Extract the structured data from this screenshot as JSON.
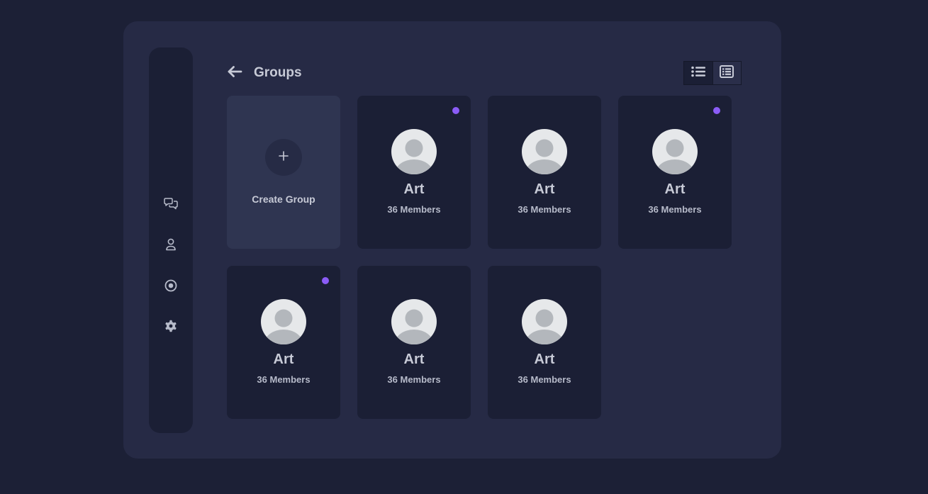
{
  "header": {
    "title": "Groups",
    "back_icon": "arrow-left-icon"
  },
  "view_toggle": {
    "options": [
      {
        "icon": "list-view-icon",
        "active": true
      },
      {
        "icon": "table-view-icon",
        "active": false
      }
    ]
  },
  "sidebar": {
    "items": [
      {
        "icon": "chat-icon"
      },
      {
        "icon": "user-icon"
      },
      {
        "icon": "status-icon"
      },
      {
        "icon": "settings-icon"
      }
    ]
  },
  "create_card": {
    "label": "Create Group",
    "icon": "plus-icon"
  },
  "groups": [
    {
      "name": "Art",
      "members": "36 Members",
      "unread": true
    },
    {
      "name": "Art",
      "members": "36 Members",
      "unread": false
    },
    {
      "name": "Art",
      "members": "36 Members",
      "unread": true
    },
    {
      "name": "Art",
      "members": "36 Members",
      "unread": true
    },
    {
      "name": "Art",
      "members": "36 Members",
      "unread": false
    },
    {
      "name": "Art",
      "members": "36 Members",
      "unread": false
    }
  ],
  "colors": {
    "background": "#1c2036",
    "panel": "#262a45",
    "card": "#1b1f35",
    "create_card": "#2f3551",
    "accent_dot": "#8b5cf6",
    "text": "#c7cad6"
  }
}
